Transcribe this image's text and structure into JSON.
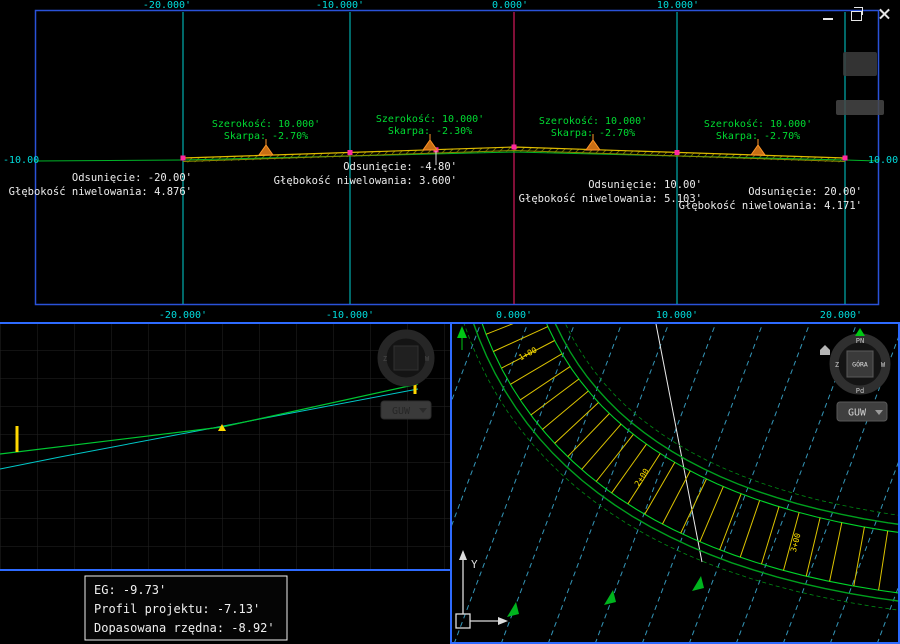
{
  "window": {
    "controls": [
      "minimize-icon",
      "restore-icon",
      "close-icon"
    ]
  },
  "section_view": {
    "axis_top": [
      "-20.000'",
      "-10.000'",
      "0.000'",
      "10.000'"
    ],
    "axis_bottom": [
      "-20.000'",
      "-10.000'",
      "0.000'",
      "10.000'",
      "20.000'"
    ],
    "elev_left": "-10.00",
    "elev_right": "10.00",
    "width_labels": [
      {
        "width": "Szerokość: 10.000'",
        "slope": "Skarpa: -2.70%"
      },
      {
        "width": "Szerokość: 10.000'",
        "slope": "Skarpa: -2.30%"
      },
      {
        "width": "Szerokość: 10.000'",
        "slope": "Skarpa: -2.70%"
      },
      {
        "width": "Szerokość: 10.000'",
        "slope": "Skarpa: -2.70%"
      }
    ],
    "grade_labels": [
      {
        "offset": "Odsunięcie: -20.00'",
        "depth": "Głębokość niwelowania: 4.876'"
      },
      {
        "offset": "Odsunięcie: -4.80'",
        "depth": "Głębokość niwelowania: 3.600'"
      },
      {
        "offset": "Odsunięcie: 10.00'",
        "depth": "Głębokość niwelowania: 5.103'"
      },
      {
        "offset": "Odsunięcie: 20.00'",
        "depth": "Głębokość niwelowania: 4.171'"
      }
    ]
  },
  "profile_view": {
    "tooltip": [
      "EG: -9.73'",
      "Profil projektu: -7.13'",
      "Dopasowana rzędna: -8.92'"
    ],
    "guw_label": "GUW",
    "viewcube": {
      "west": "Z",
      "east": "W"
    }
  },
  "plan_view": {
    "viewcube": {
      "face": "GÓRA",
      "north": "PN",
      "south": "Pd",
      "west": "Z",
      "east": "W"
    },
    "guw_label": "GUW",
    "ucs_axis": "Y",
    "stations": [
      "1+00",
      "2+00",
      "3+00"
    ]
  },
  "colors": {
    "viewport_border": "#2e6bff",
    "grid_cyan": "#00d0d0",
    "centerline_magenta": "#ff1e6e",
    "annotation_green": "#00dc32",
    "corridor_green": "#00a01e",
    "tie_yellow": "#dcc400",
    "contour_cyan": "#3aa7cc",
    "slope_symbol_orange": "#ff9628",
    "marker_magenta": "#ff28a0"
  }
}
